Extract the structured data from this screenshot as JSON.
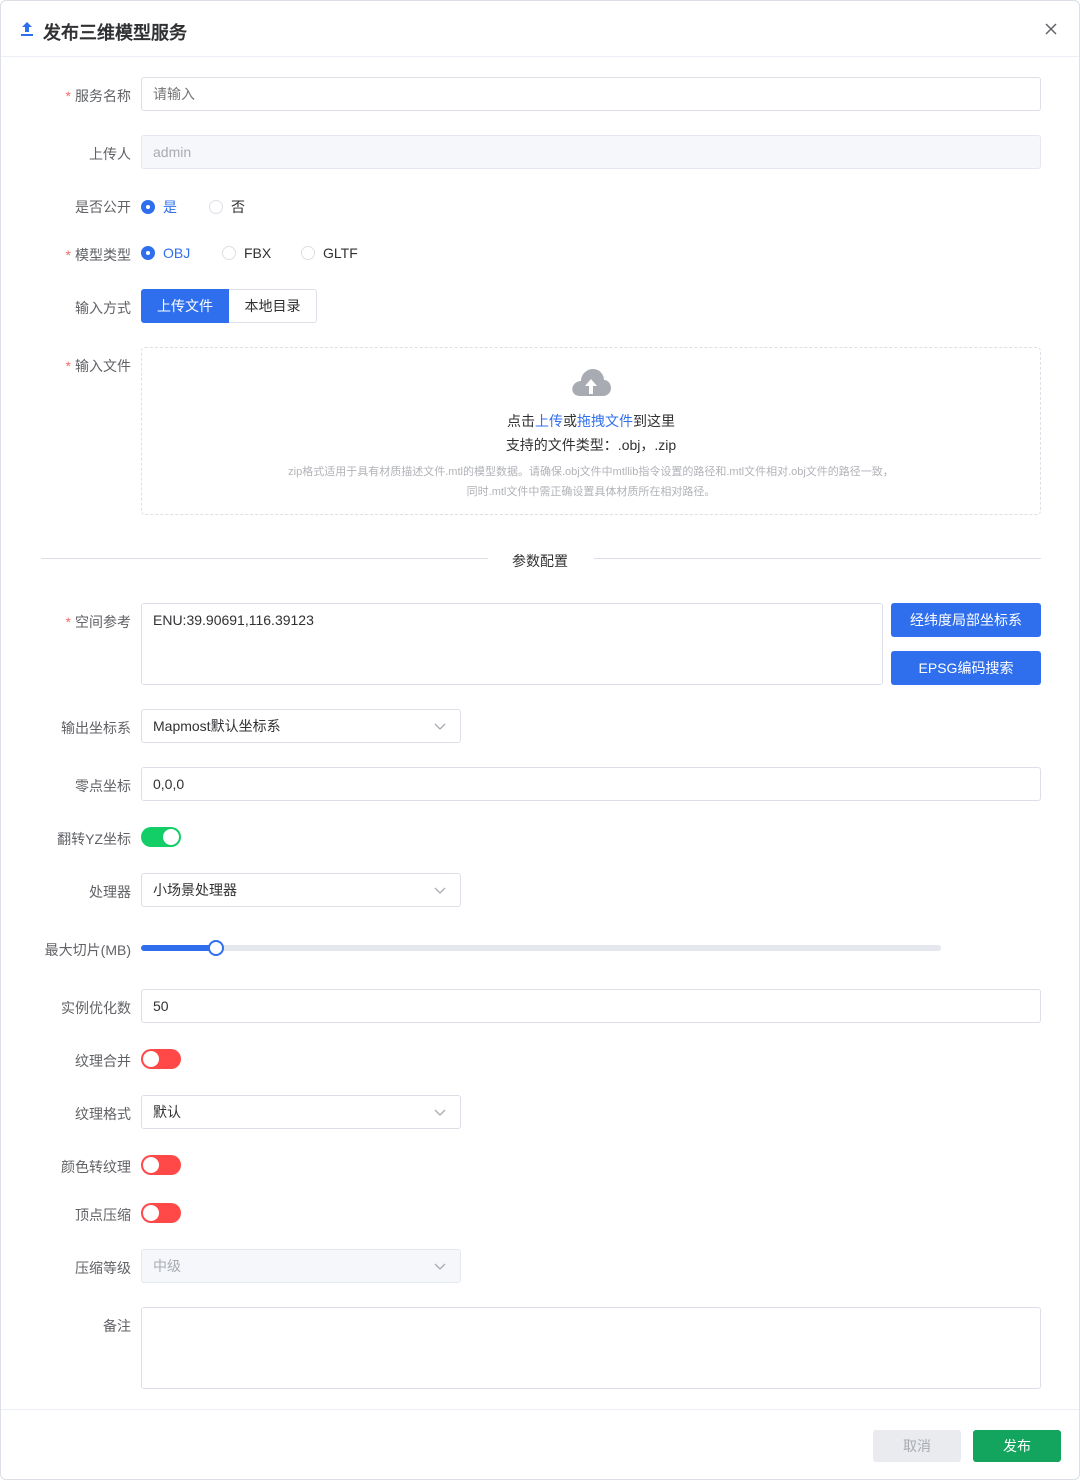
{
  "dialog": {
    "title": "发布三维模型服务",
    "close_icon": "close-icon",
    "upload_icon": "upload-icon",
    "accent_color": "#2f6fee"
  },
  "form": {
    "service_name": {
      "label": "服务名称",
      "placeholder": "请输入"
    },
    "uploader": {
      "label": "上传人",
      "value": "admin"
    },
    "is_public": {
      "label": "是否公开",
      "options": [
        "是",
        "否"
      ],
      "selected": "是"
    },
    "model_type": {
      "label": "模型类型",
      "options": [
        "OBJ",
        "FBX",
        "GLTF"
      ],
      "selected": "OBJ"
    },
    "input_mode": {
      "label": "输入方式",
      "options": [
        "上传文件",
        "本地目录"
      ],
      "selected": "上传文件"
    },
    "input_file": {
      "label": "输入文件",
      "text_prefix": "点击",
      "link_upload": "上传",
      "text_or": "或",
      "link_drag": "拖拽文件",
      "text_suffix": "到这里",
      "types_label": "支持的文件类型：.obj，.zip",
      "hint_line1": "zip格式适用于具有材质描述文件.mtl的模型数据。请确保.obj文件中mtllib指令设置的路径和.mtl文件相对.obj文件的路径一致，",
      "hint_line2": "同时.mtl文件中需正确设置具体材质所在相对路径。"
    },
    "section_title": "参数配置",
    "spatial_ref": {
      "label": "空间参考",
      "value": "ENU:39.90691,116.39123",
      "btn_local": "经纬度局部坐标系",
      "btn_epsg": "EPSG编码搜索"
    },
    "output_crs": {
      "label": "输出坐标系",
      "value": "Mapmost默认坐标系"
    },
    "zero_point": {
      "label": "零点坐标",
      "value": "0,0,0"
    },
    "flip_yz": {
      "label": "翻转YZ坐标",
      "on": true
    },
    "processor": {
      "label": "处理器",
      "value": "小场景处理器"
    },
    "max_tile": {
      "label": "最大切片(MB)",
      "fraction": 0.094
    },
    "instance_opt": {
      "label": "实例优化数",
      "value": "50"
    },
    "texture_merge": {
      "label": "纹理合并",
      "on": false
    },
    "texture_format": {
      "label": "纹理格式",
      "value": "默认"
    },
    "color_to_texture": {
      "label": "颜色转纹理",
      "on": false
    },
    "vertex_compress": {
      "label": "顶点压缩",
      "on": false
    },
    "compress_level": {
      "label": "压缩等级",
      "value": "中级"
    },
    "remark": {
      "label": "备注",
      "value": ""
    }
  },
  "footer": {
    "cancel_label": "取消",
    "publish_label": "发布"
  }
}
